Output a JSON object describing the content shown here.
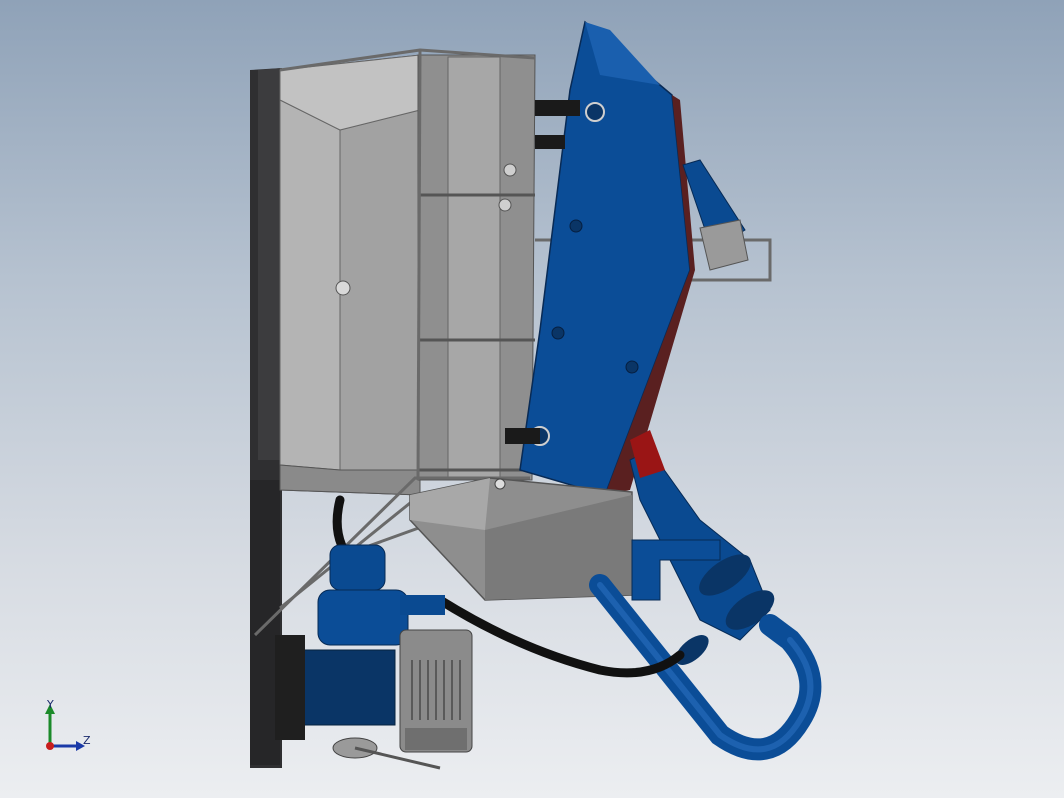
{
  "scene": {
    "description_type": "cad-assembly",
    "colors": {
      "frame_dark": "#2f2f31",
      "frame_grey": "#8d8d8d",
      "panel_grey": "#a6a6a6",
      "panel_light": "#c9c9c9",
      "blue_main": "#0a4a91",
      "blue_dark": "#0a3566",
      "red_accent": "#9a1515",
      "hose_black": "#111111"
    }
  },
  "triad": {
    "y_label": "Y",
    "z_label": "Z",
    "colors": {
      "y": "#1b8a2a",
      "z": "#1a3aa8",
      "origin": "#c81e1e"
    }
  }
}
